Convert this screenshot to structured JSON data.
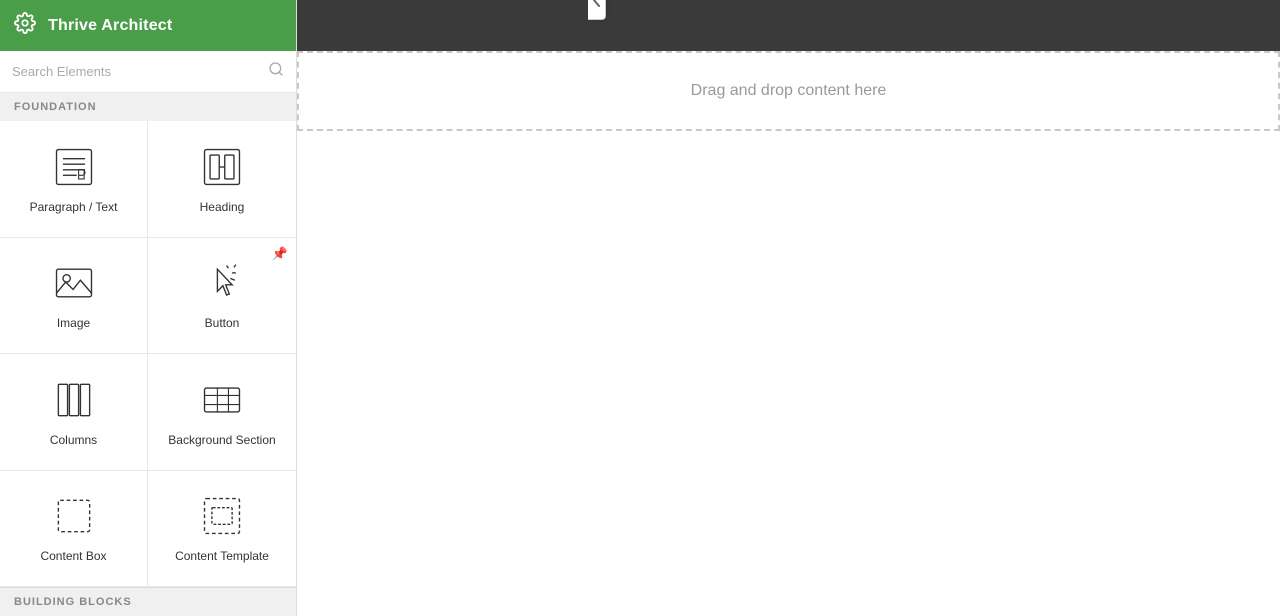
{
  "app": {
    "title": "Thrive Architect"
  },
  "sidebar": {
    "search_placeholder": "Search Elements",
    "foundation_label": "FOUNDATION",
    "building_blocks_label": "BUILDING BLOCKS",
    "elements": [
      {
        "id": "paragraph-text",
        "label": "Paragraph / Text",
        "icon": "paragraph"
      },
      {
        "id": "heading",
        "label": "Heading",
        "icon": "heading"
      },
      {
        "id": "image",
        "label": "Image",
        "icon": "image"
      },
      {
        "id": "button",
        "label": "Button",
        "icon": "button"
      },
      {
        "id": "columns",
        "label": "Columns",
        "icon": "columns"
      },
      {
        "id": "background-section",
        "label": "Background Section",
        "icon": "background-section"
      },
      {
        "id": "content-box",
        "label": "Content Box",
        "icon": "content-box"
      },
      {
        "id": "content-template",
        "label": "Content Template",
        "icon": "content-template"
      }
    ]
  },
  "canvas": {
    "drop_text": "Drag and drop content here"
  }
}
